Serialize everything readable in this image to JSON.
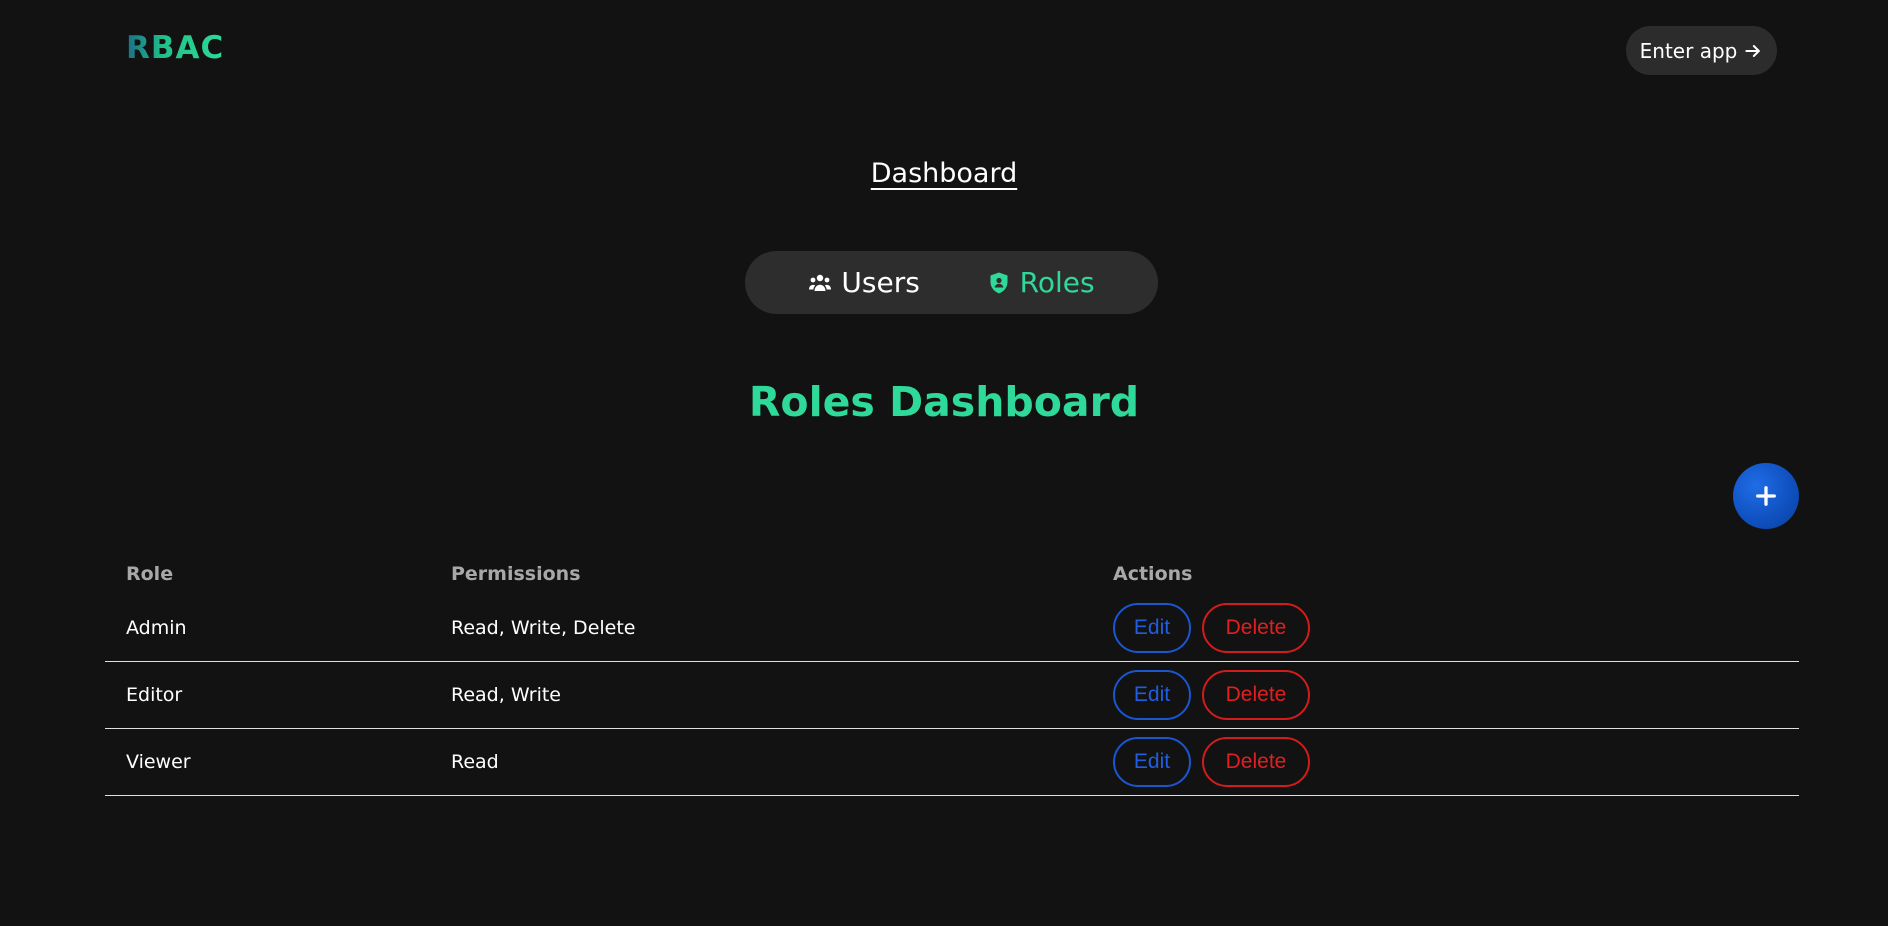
{
  "header": {
    "logo": "RBAC",
    "enter_app_label": "Enter app",
    "enter_app_icon": "arrow-right-icon"
  },
  "breadcrumb": {
    "label": "Dashboard"
  },
  "tabs": [
    {
      "label": "Users",
      "icon": "users-icon",
      "active": false
    },
    {
      "label": "Roles",
      "icon": "shield-user-icon",
      "active": true
    }
  ],
  "main": {
    "title": "Roles Dashboard",
    "add_icon": "plus-icon"
  },
  "table": {
    "columns": [
      "Role",
      "Permissions",
      "Actions"
    ],
    "rows": [
      {
        "role": "Admin",
        "permissions": "Read, Write, Delete",
        "edit": "Edit",
        "delete": "Delete"
      },
      {
        "role": "Editor",
        "permissions": "Read, Write",
        "edit": "Edit",
        "delete": "Delete"
      },
      {
        "role": "Viewer",
        "permissions": "Read",
        "edit": "Edit",
        "delete": "Delete"
      }
    ]
  },
  "colors": {
    "background": "#121212",
    "accent_green": "#2ed99a",
    "edit_blue": "#1a56d1",
    "delete_red": "#d21c1c",
    "add_button_blue": "#0f4fbe"
  }
}
